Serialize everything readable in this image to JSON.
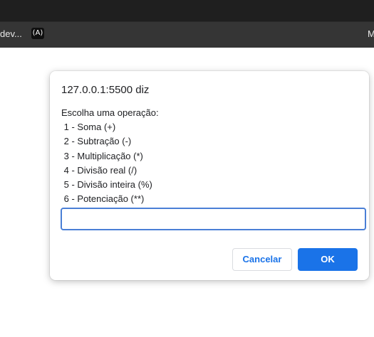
{
  "browser": {
    "bookmarks": {
      "left_label": "dev...",
      "icon_glyph": "(A)",
      "right_label": "M"
    }
  },
  "dialog": {
    "title": "127.0.0.1:5500 diz",
    "message_lines": [
      "Escolha uma operação:",
      " 1 - Soma (+)",
      " 2 - Subtração (-)",
      " 3 - Multiplicação (*)",
      " 4 - Divisão real (/)",
      " 5 - Divisão inteira (%)",
      " 6 - Potenciação (**)"
    ],
    "input_value": "",
    "cancel_label": "Cancelar",
    "ok_label": "OK"
  },
  "colors": {
    "accent": "#1a73e8",
    "input_border": "#4a7fd6",
    "browser_dark": "#1f1f1f",
    "bookmarks_bar": "#353535"
  }
}
